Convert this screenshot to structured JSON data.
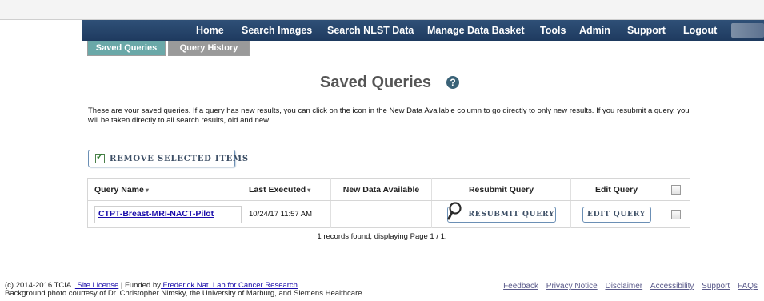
{
  "nav": {
    "home": "Home",
    "search_images": "Search Images",
    "search_nlst": "Search NLST Data",
    "manage_basket": "Manage Data Basket",
    "tools": "Tools",
    "admin": "Admin",
    "support": "Support",
    "logout": "Logout"
  },
  "tabs": {
    "saved": "Saved Queries",
    "history": "Query History"
  },
  "page": {
    "title": "Saved Queries",
    "help_glyph": "?",
    "intro": "These are your saved queries. If a query has new results, you can click on the icon in the New Data Available column to go directly to only new results. If you resubmit a query, you will be taken directly to all search results, old and new."
  },
  "remove_button": {
    "label": "REMOVE SELECTED ITEMS",
    "check_glyph": "✓"
  },
  "table": {
    "headers": {
      "query_name": "Query Name",
      "last_executed": "Last Executed",
      "new_data": "New Data Available",
      "resubmit": "Resubmit Query",
      "edit": "Edit Query"
    },
    "sort_glyph": "▾",
    "rows": [
      {
        "query_name": "CTPT-Breast-MRI-NACT-Pilot",
        "last_executed": "10/24/17 11:57 AM",
        "new_data": "",
        "resubmit_label": "RESUBMIT QUERY",
        "edit_label": "EDIT QUERY"
      }
    ]
  },
  "records_text": "1 records found, displaying Page 1 / 1.",
  "footer": {
    "copy_prefix": "(c) 2014-2016 TCIA |",
    "site_license": " Site License",
    "funded_by": " | Funded by",
    "fnl_link": " Frederick Nat. Lab for Cancer Research",
    "photo_credit": "Background photo courtesy of Dr. Christopher Nimsky, the University of Marburg, and Siemens Healthcare",
    "links": {
      "feedback": "Feedback",
      "privacy": "Privacy Notice",
      "disclaimer": "Disclaimer",
      "accessibility": "Accessibility",
      "support": "Support",
      "faqs": "FAQs"
    }
  }
}
